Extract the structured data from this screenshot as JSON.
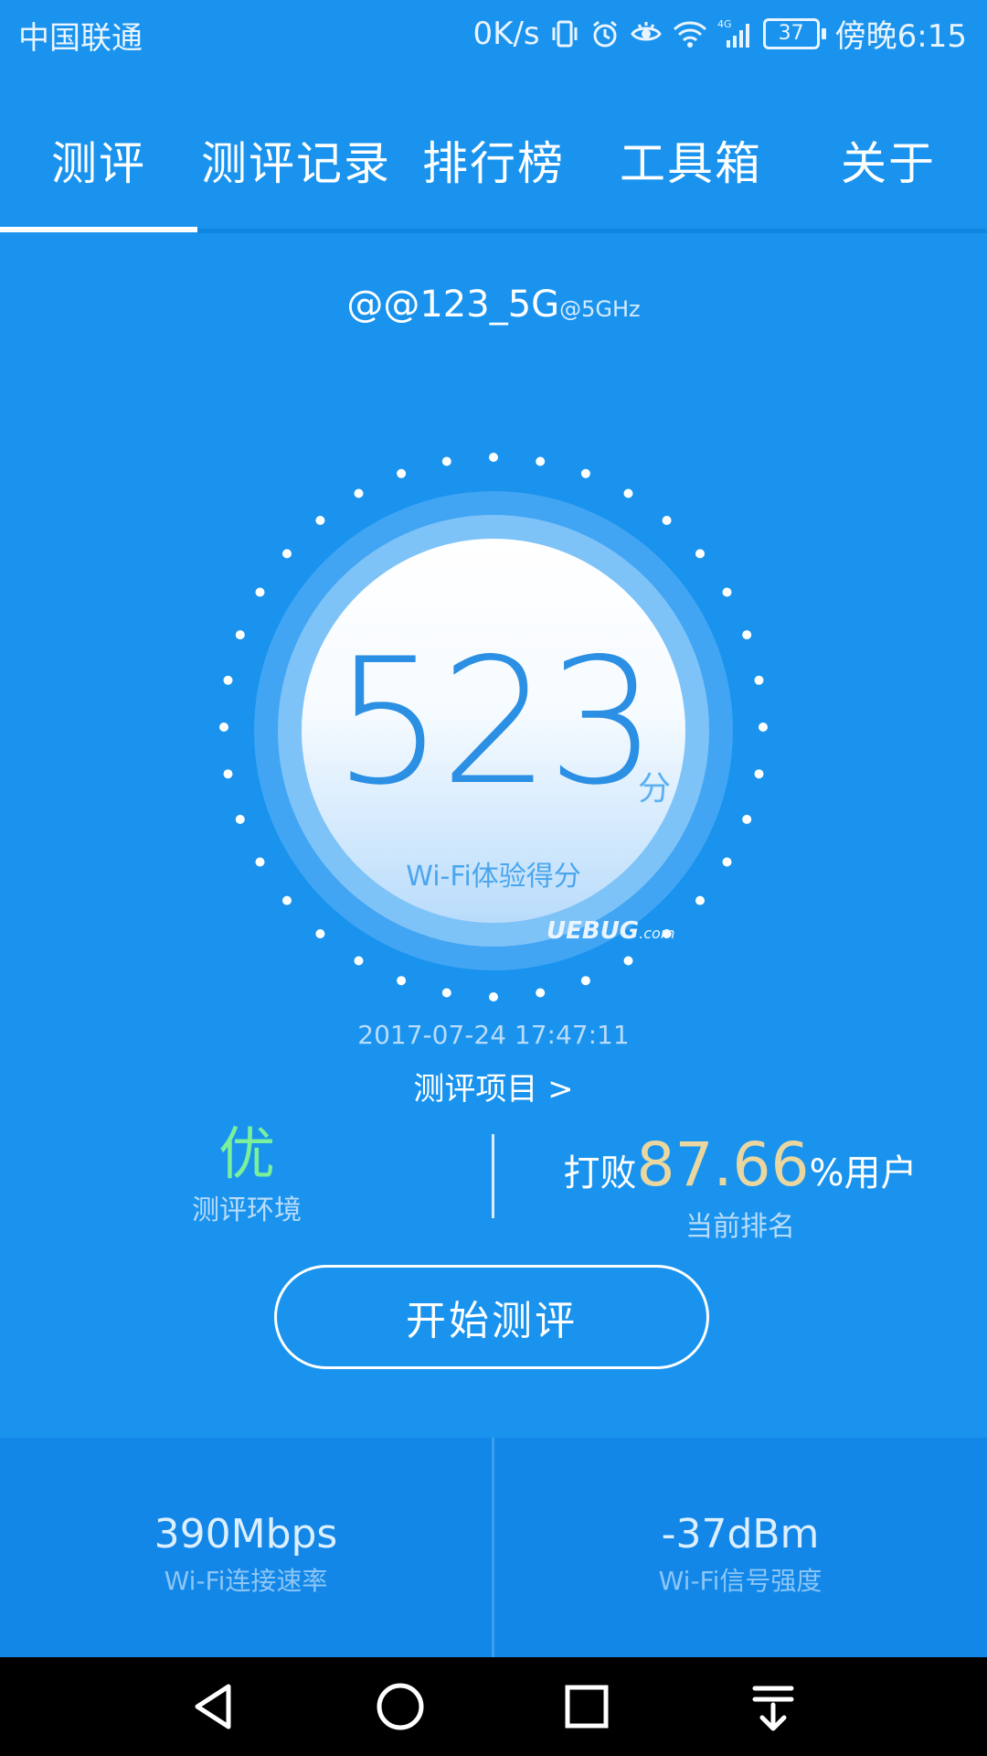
{
  "status_bar": {
    "carrier": "中国联通",
    "net_speed": "0K/s",
    "battery": "37",
    "time": "傍晚6:15",
    "icons": [
      "vibrate-icon",
      "alarm-icon",
      "eye-icon",
      "wifi-icon",
      "cellular-4g-icon",
      "battery-icon"
    ]
  },
  "tabs": [
    {
      "label": "测评",
      "active": true
    },
    {
      "label": "测评记录",
      "active": false
    },
    {
      "label": "排行榜",
      "active": false
    },
    {
      "label": "工具箱",
      "active": false
    },
    {
      "label": "关于",
      "active": false
    }
  ],
  "network": {
    "ssid": "@@123_5G",
    "band": "@5GHz"
  },
  "score": {
    "value": "523",
    "unit": "分",
    "label": "Wi-Fi体验得分"
  },
  "watermark": {
    "text": "UEBUG",
    "suffix": ".com"
  },
  "timestamp": "2017-07-24 17:47:11",
  "eval_items_link": "测评项目 >",
  "environment": {
    "grade": "优",
    "label": "测评环境"
  },
  "ranking": {
    "prefix": "打败",
    "value": "87.66",
    "suffix": "%用户",
    "label": "当前排名"
  },
  "start_button": "开始测评",
  "stats": [
    {
      "value": "390Mbps",
      "label": "Wi-Fi连接速率"
    },
    {
      "value": "-37dBm",
      "label": "Wi-Fi信号强度"
    }
  ],
  "nav_bar": {
    "icons": [
      "back-icon",
      "home-icon",
      "recents-icon",
      "notification-pull-icon"
    ]
  },
  "colors": {
    "background": "#1993ee",
    "score": "#2b8fe4",
    "grade": "#7af09a",
    "rank_value": "#ead7a0"
  }
}
